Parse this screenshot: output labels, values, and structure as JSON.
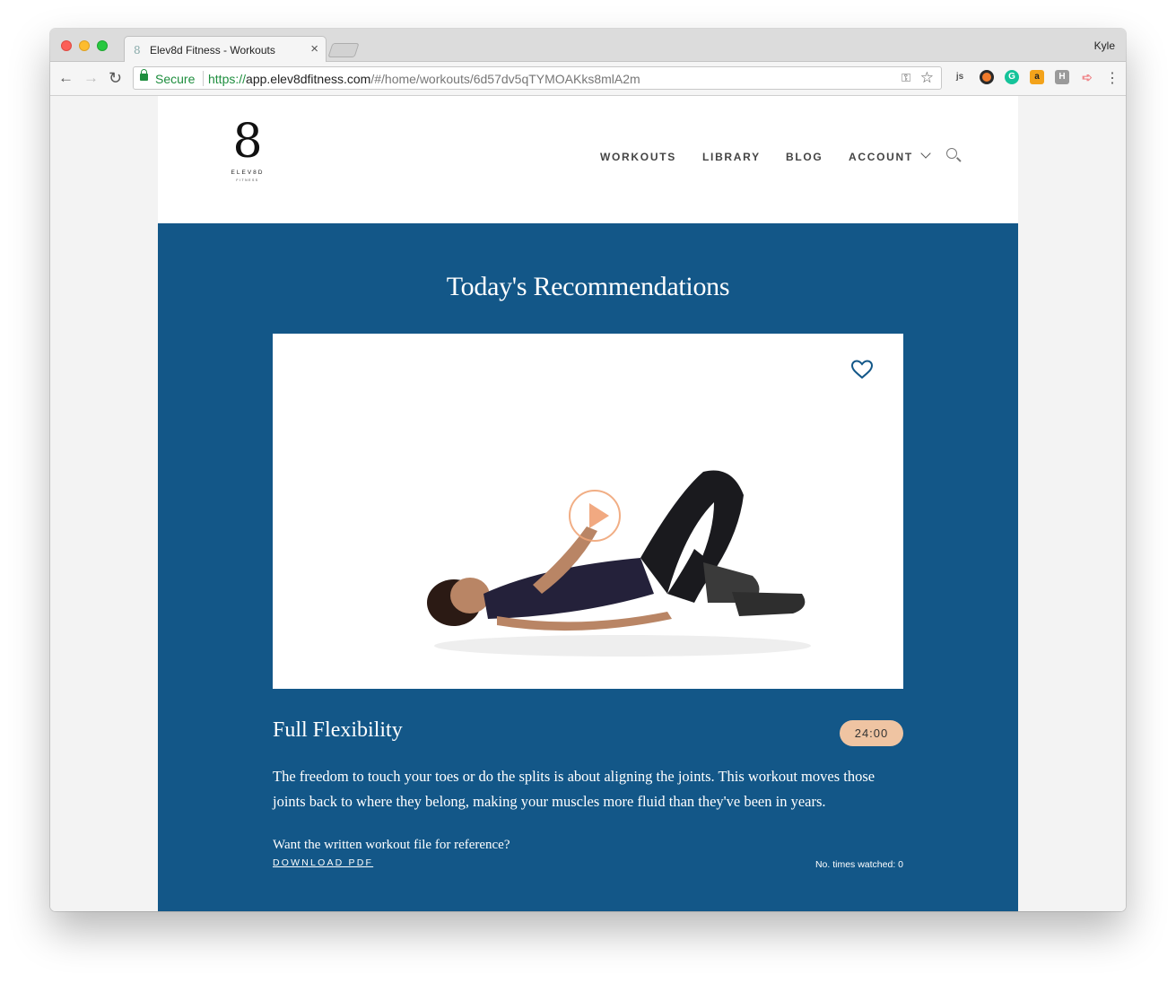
{
  "browser": {
    "tab_title": "Elev8d Fitness - Workouts",
    "tab_favicon": "8",
    "tab_close": "×",
    "profile_name": "Kyle",
    "secure_label": "Secure",
    "url_scheme": "https://",
    "url_host": "app.elev8dfitness.com",
    "url_path": "/#/home/workouts/6d57dv5qTYMOAKks8mlA2m",
    "nav_back": "←",
    "nav_forward": "→",
    "nav_reload": "↻",
    "key_icon": "⚿",
    "star_icon": "☆",
    "menu_icon": "⋮",
    "extensions": {
      "js": "js",
      "grammarly": "G",
      "amazon": "a",
      "h": "H",
      "pb": "➪"
    }
  },
  "site": {
    "logo": {
      "glyph": "8",
      "word": "ELEV8D",
      "sub": "FITNESS"
    },
    "nav": {
      "workouts": "WORKOUTS",
      "library": "LIBRARY",
      "blog": "BLOG",
      "account": "ACCOUNT"
    },
    "hero": {
      "title": "Today's Recommendations"
    },
    "workout": {
      "title": "Full Flexibility",
      "duration": "24:00",
      "description": "The freedom to touch your toes or do the splits is about aligning the joints. This workout moves those joints back to where they belong, making your muscles more fluid than they've been in years.",
      "pdf_prompt": "Want the written workout file for reference?",
      "download_label": "DOWNLOAD PDF",
      "times_watched": "No. times watched: 0"
    }
  },
  "colors": {
    "hero_bg": "#135788",
    "badge_bg": "#efc4a2",
    "play_accent": "#f0a378"
  }
}
